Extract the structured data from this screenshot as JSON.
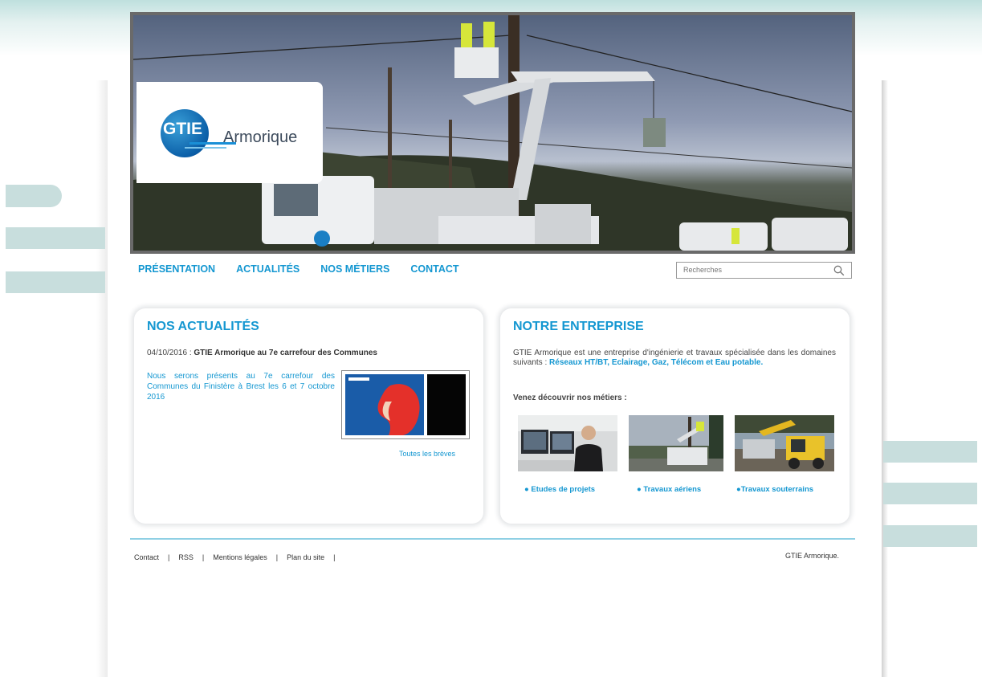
{
  "brand": {
    "short": "GTIE",
    "name": "Armorique"
  },
  "nav": {
    "items": [
      "PRÉSENTATION",
      "ACTUALITÉS",
      "NOS MÉTIERS",
      "CONTACT"
    ]
  },
  "search": {
    "placeholder": "Recherches"
  },
  "news": {
    "title": "NOS ACTUALITÉS",
    "date": "04/10/2016 :",
    "headline": "GTIE Armorique au 7e carrefour des Communes",
    "body": "Nous serons présents au 7e carrefour des Communes du Finistère à Brest les 6 et 7 octobre 2016",
    "all_link": "Toutes les brèves"
  },
  "company": {
    "title": "NOTRE ENTREPRISE",
    "intro": "GTIE Armorique est une entreprise d'ingénierie et travaux spécialisée dans les domaines suivants :",
    "domains": "Réseaux HT/BT, Eclairage, Gaz, Télécom et Eau potable.",
    "discover": "Venez découvrir nos métiers :",
    "jobs": [
      "● Etudes de projets",
      "● Travaux aériens",
      "●Travaux souterrains"
    ]
  },
  "footer": {
    "links": [
      "Contact",
      "RSS",
      "Mentions légales",
      "Plan du site"
    ],
    "separator": "|",
    "copyright": "GTIE Armorique."
  },
  "colors": {
    "accent": "#1497d1",
    "band": "#c8dedd",
    "text": "#444444"
  }
}
